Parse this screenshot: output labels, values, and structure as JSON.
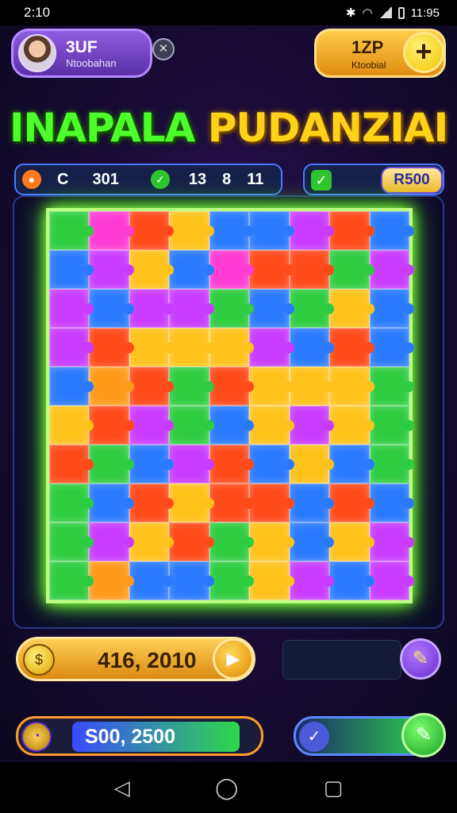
{
  "status_bar": {
    "time": "2:10",
    "battery": "11:95"
  },
  "player": {
    "name": "3UF",
    "subtitle": "Ntoobahan"
  },
  "currency": {
    "value": "1ZP",
    "label": "Ktoobial",
    "add_icon": "plus-icon"
  },
  "title": {
    "part1": "INAPALA",
    "part2": "PUDANZIAI"
  },
  "stats": {
    "label": "C",
    "value1": "301",
    "value2": "13",
    "value3": "8",
    "value4": "11"
  },
  "prize": {
    "value": "R500"
  },
  "board": {
    "columns": 9,
    "rows": 10,
    "colors": [
      "#2ecc40",
      "#ff3bd4",
      "#ff4a1a",
      "#ffc21a",
      "#2a7aff",
      "#2a7aff",
      "#c93bff",
      "#ff4a1a",
      "#2a7aff",
      "#2a7aff",
      "#c93bff",
      "#ffc21a",
      "#2a7aff",
      "#ff3bd4",
      "#ff4a1a",
      "#ff4a1a",
      "#2ecc40",
      "#c93bff",
      "#c93bff",
      "#2a7aff",
      "#c93bff",
      "#c93bff",
      "#2ecc40",
      "#2a7aff",
      "#2ecc40",
      "#ffc21a",
      "#2a7aff",
      "#c93bff",
      "#ff4a1a",
      "#ffc21a",
      "#ffc21a",
      "#ffc21a",
      "#c93bff",
      "#2a7aff",
      "#ff4a1a",
      "#2a7aff",
      "#2a7aff",
      "#ff9a1a",
      "#ff4a1a",
      "#2ecc40",
      "#ff4a1a",
      "#ffc21a",
      "#ffc21a",
      "#ffc21a",
      "#2ecc40",
      "#ffc21a",
      "#ff4a1a",
      "#c93bff",
      "#2ecc40",
      "#2a7aff",
      "#ffc21a",
      "#c93bff",
      "#ffc21a",
      "#2ecc40",
      "#ff4a1a",
      "#2ecc40",
      "#2a7aff",
      "#c93bff",
      "#ff4a1a",
      "#2a7aff",
      "#ffc21a",
      "#2a7aff",
      "#2ecc40",
      "#2ecc40",
      "#2a7aff",
      "#ff4a1a",
      "#ffc21a",
      "#ff4a1a",
      "#ff4a1a",
      "#2a7aff",
      "#ff4a1a",
      "#2a7aff",
      "#2ecc40",
      "#c93bff",
      "#ffc21a",
      "#ff4a1a",
      "#2ecc40",
      "#ffc21a",
      "#2a7aff",
      "#ffc21a",
      "#c93bff",
      "#2ecc40",
      "#ff9a1a",
      "#2a7aff",
      "#2a7aff",
      "#2ecc40",
      "#ffc21a",
      "#c93bff",
      "#2a7aff",
      "#c93bff"
    ]
  },
  "score": {
    "value": "416, 2010"
  },
  "timer": {
    "value": "S00, 2500",
    "fill": 0.9
  },
  "nav": {
    "back": "◁",
    "home": "◯",
    "recent": "▢"
  }
}
